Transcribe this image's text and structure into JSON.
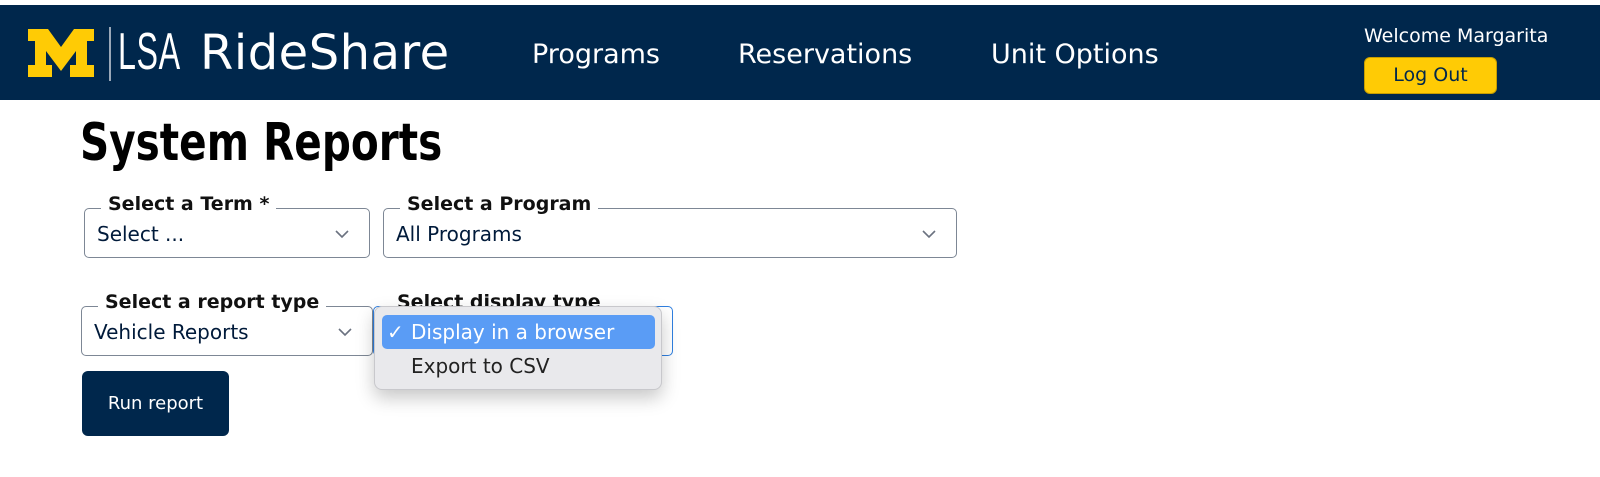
{
  "header": {
    "logo_text": "M",
    "lsa_text": "LSA",
    "app_name": "RideShare",
    "nav": [
      "Programs",
      "Reservations",
      "Unit Options"
    ],
    "welcome": "Welcome Margarita",
    "logout_label": "Log Out"
  },
  "main": {
    "title": "System Reports",
    "term": {
      "label": "Select a Term *",
      "value": "Select ..."
    },
    "program": {
      "label": "Select a Program",
      "value": "All Programs"
    },
    "report_type": {
      "label": "Select a report type",
      "value": "Vehicle Reports"
    },
    "display_type": {
      "label": "Select display type",
      "options": [
        "Display in a browser",
        "Export to CSV"
      ],
      "selected_mark": "✓"
    },
    "run_label": "Run report"
  },
  "colors": {
    "navy": "#00274c",
    "maize": "#ffcb05",
    "selected_option": "#5a9cf5"
  }
}
